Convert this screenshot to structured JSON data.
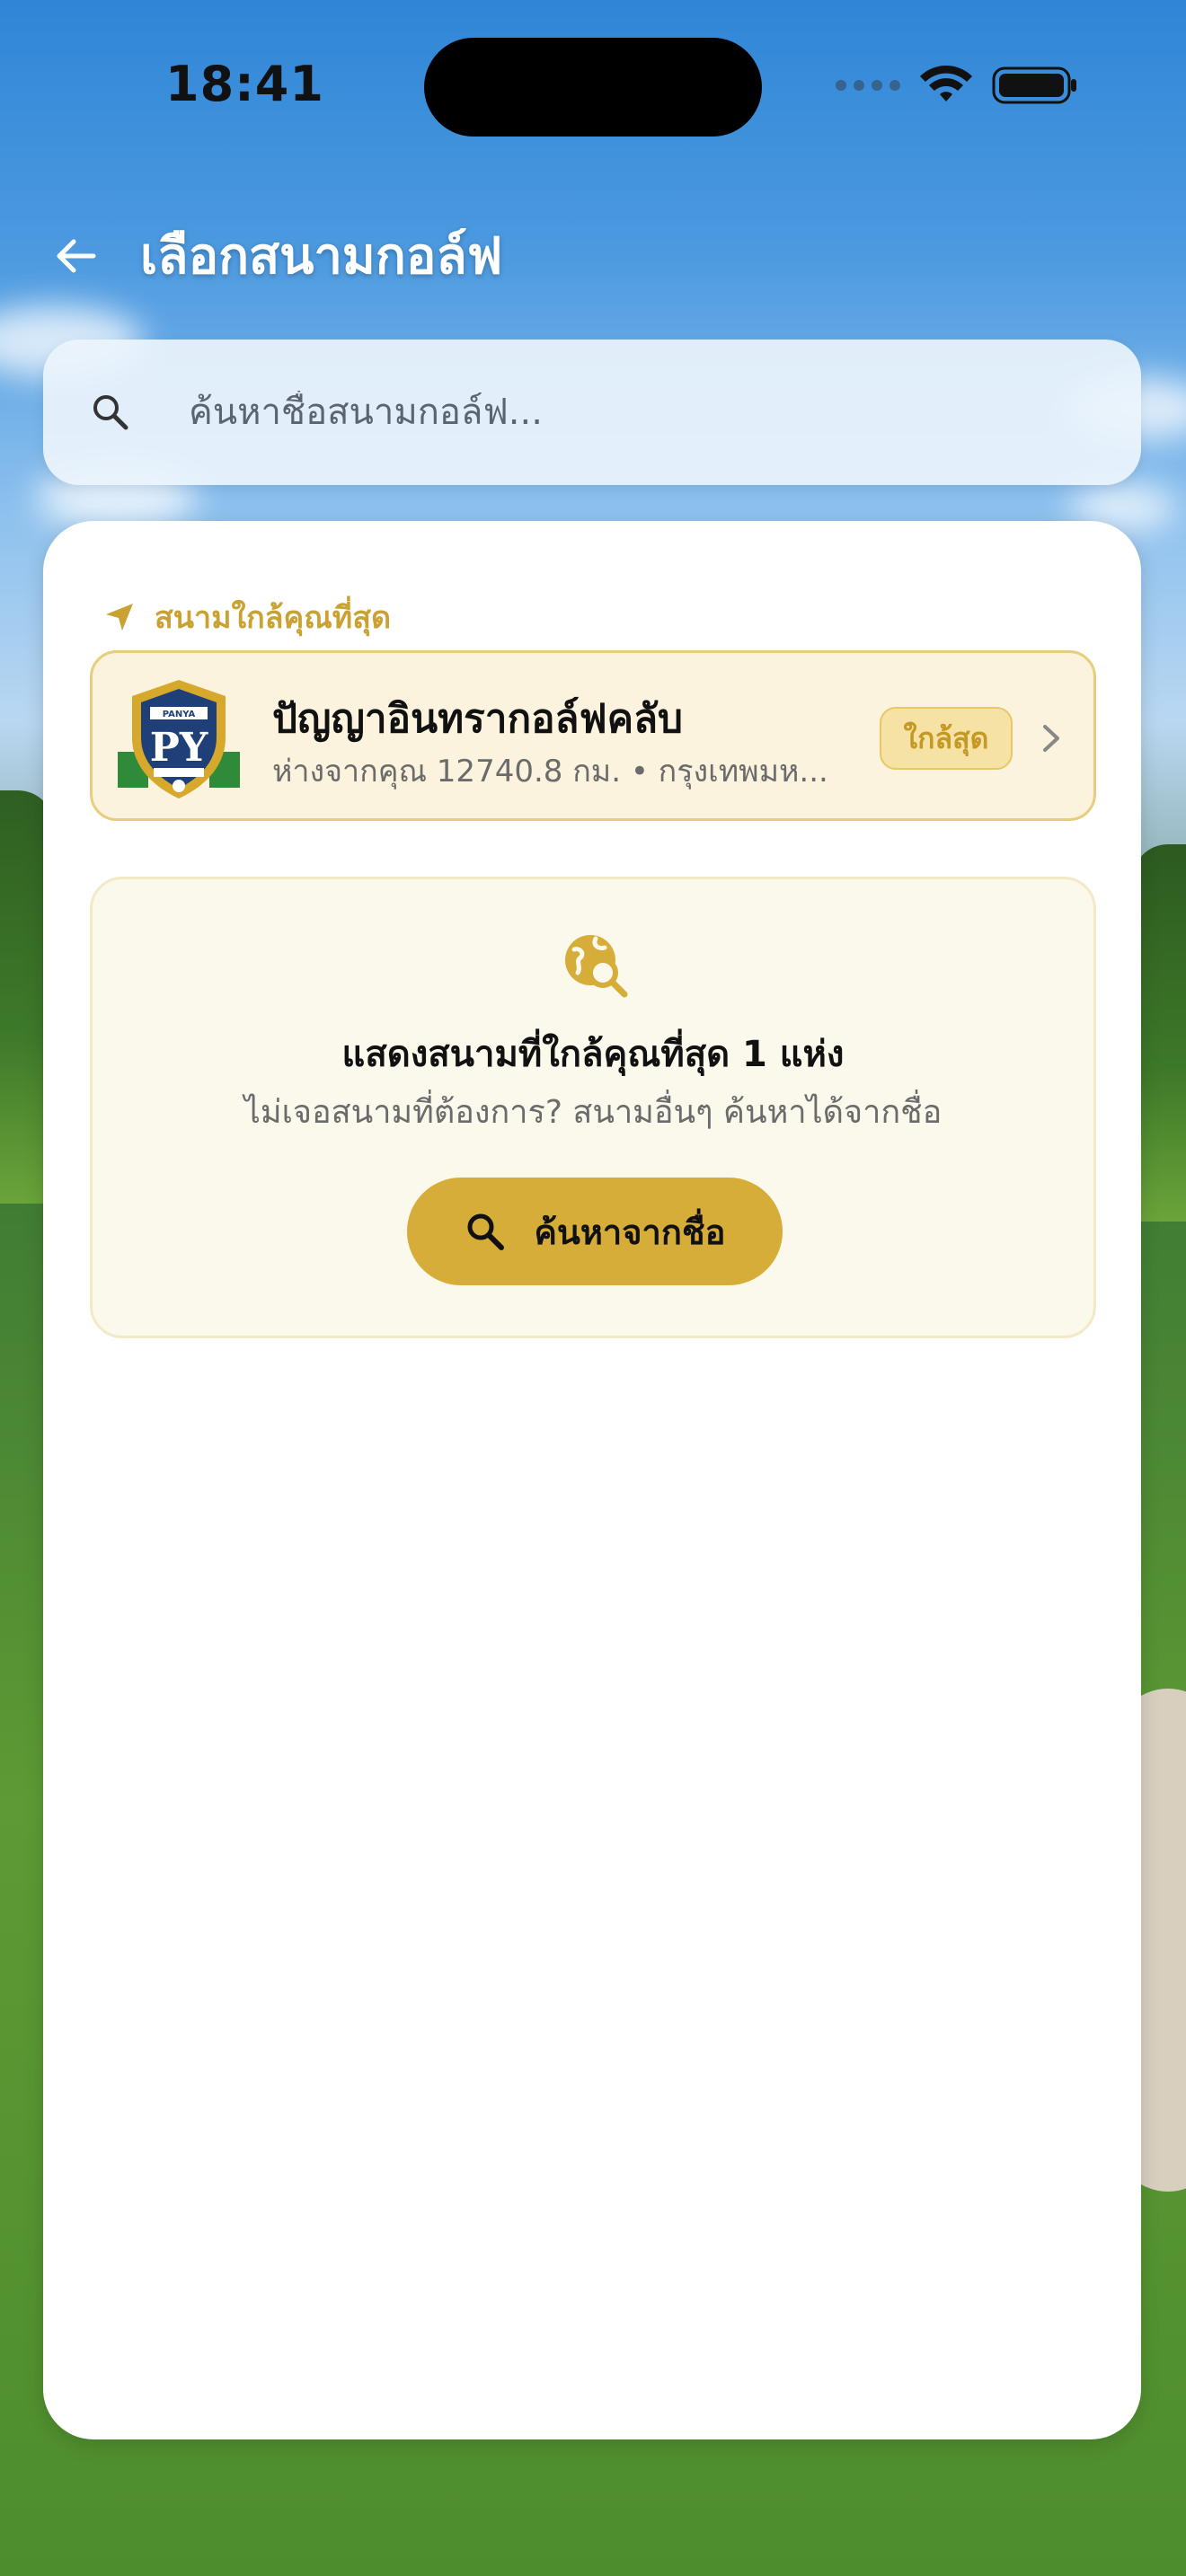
{
  "status_bar": {
    "time": "18:41"
  },
  "header": {
    "title": "เลือกสนามกอล์ฟ",
    "back_icon": "arrow-left-icon"
  },
  "search": {
    "placeholder": "ค้นหาชื่อสนามกอล์ฟ..."
  },
  "nearest_section": {
    "label": "สนามใกล้คุณที่สุด",
    "course": {
      "name": "ปัญญาอินทรากอล์ฟคลับ",
      "meta": "ห่างจากคุณ 12740.8 กม. • กรุงเทพมห...",
      "badge": "ใกล้สุด",
      "logo_text": "PANYA"
    }
  },
  "info_card": {
    "title": "แสดงสนามที่ใกล้คุณที่สุด 1 แห่ง",
    "subtitle": "ไม่เจอสนามที่ต้องการ? สนามอื่นๆ ค้นหาได้จากชื่อ",
    "button_label": "ค้นหาจากชื่อ"
  },
  "colors": {
    "accent_gold": "#d6ad38",
    "badge_bg": "#f5e2a4",
    "card_bg": "#fbf3dd",
    "info_bg": "#fbf8ec"
  }
}
